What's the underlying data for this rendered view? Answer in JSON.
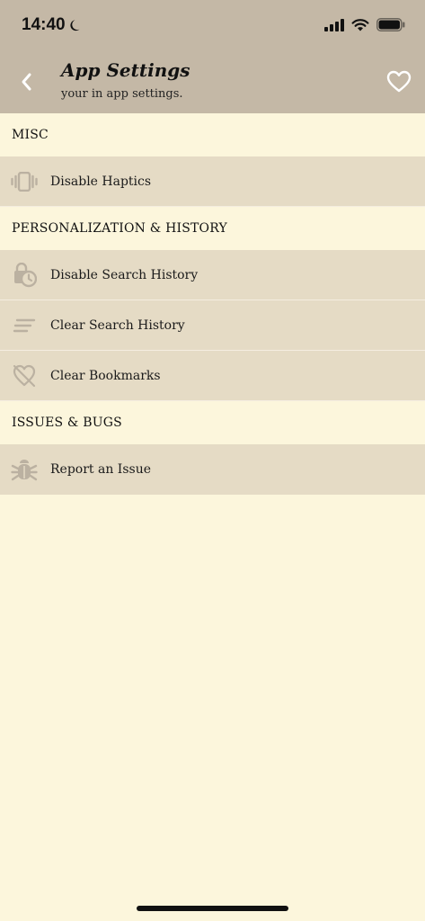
{
  "status_bar": {
    "time": "14:40"
  },
  "nav": {
    "title": "App Settings",
    "subtitle": "your in app settings."
  },
  "sections": [
    {
      "header": "MISC",
      "items": [
        {
          "label": "Disable Haptics",
          "icon": "vibration-icon"
        }
      ]
    },
    {
      "header": "PERSONALIZATION & HISTORY",
      "items": [
        {
          "label": "Disable Search History",
          "icon": "history-lock-icon"
        },
        {
          "label": "Clear Search History",
          "icon": "clear-lines-icon"
        },
        {
          "label": "Clear Bookmarks",
          "icon": "heart-off-icon"
        }
      ]
    },
    {
      "header": "ISSUES & BUGS",
      "items": [
        {
          "label": "Report an Issue",
          "icon": "bug-icon"
        }
      ]
    }
  ],
  "colors": {
    "header_bg": "#c4b8a6",
    "page_bg": "#fcf6dc",
    "row_bg": "#e5dbc5",
    "icon_color": "#bbb1a1"
  }
}
